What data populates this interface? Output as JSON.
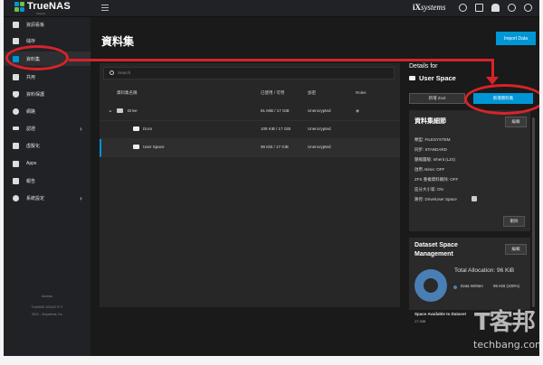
{
  "brand": {
    "name": "TrueNAS",
    "sub": "SCALE"
  },
  "topbar": {
    "vendor_prefix": "iX",
    "vendor": "systems"
  },
  "sidebar": {
    "items": [
      {
        "label": "資訊看板",
        "icon": "dashboard-icon"
      },
      {
        "label": "儲存",
        "icon": "storage-icon"
      },
      {
        "label": "資料集",
        "icon": "datasets-icon"
      },
      {
        "label": "共用",
        "icon": "shares-icon"
      },
      {
        "label": "資料保護",
        "icon": "shield-icon"
      },
      {
        "label": "網路",
        "icon": "network-icon"
      },
      {
        "label": "認證",
        "icon": "key-icon"
      },
      {
        "label": "虛擬化",
        "icon": "monitor-icon"
      },
      {
        "label": "Apps",
        "icon": "apps-icon"
      },
      {
        "label": "報告",
        "icon": "reports-icon"
      },
      {
        "label": "系統設定",
        "icon": "gear-icon"
      }
    ],
    "footer_host": "truenas",
    "footer_version": "TrueNAS SCALE ® ©",
    "footer_copy": "2023 - iXsystems, Inc"
  },
  "main": {
    "title": "資料集",
    "import_label": "Import Data",
    "search_placeholder": "Search",
    "columns": [
      "資料集名稱",
      "已使用 / 可用",
      "加密",
      "Roles"
    ],
    "rows": [
      {
        "name": "Drive",
        "used": "81 MiB / 17 GiB",
        "enc": "Unencrypted"
      },
      {
        "name": "Docs",
        "used": "108 KiB / 17 GiB",
        "enc": "Unencrypted"
      },
      {
        "name": "User Space",
        "used": "96 KiB / 17 GiB",
        "enc": "Unencrypted"
      }
    ]
  },
  "details": {
    "heading": "Details for",
    "dataset": "User Space",
    "add_zvol": "新增 Zvol",
    "add_dataset": "新增資料集",
    "card1": {
      "title": "資料集細節",
      "edit": "編輯",
      "lines": [
        "類型: FILESYSTEM",
        "同步: STANDARD",
        "壓縮層級: Inherit (LZ4)",
        "啟用 Atime: OFF",
        "ZFS 重複資料刪除: OFF",
        "區分大小寫: ON",
        "路徑: Drive/User Space"
      ],
      "delete": "刪除"
    },
    "card2": {
      "title_line1": "Dataset Space",
      "title_line2": "Management",
      "edit": "編輯",
      "total": "Total Allocation: 96 KiB",
      "legend": "Data Written",
      "legend_value": "96 KiB (100%)",
      "footer": "Space Available to Dataset",
      "footer_value": "17 GiB"
    }
  },
  "watermark": {
    "cn": "T客邦",
    "en": "techbang.com"
  },
  "colors": {
    "accent": "#0095d5",
    "annotation": "#d8232a",
    "donut": "#4a7fb5"
  }
}
